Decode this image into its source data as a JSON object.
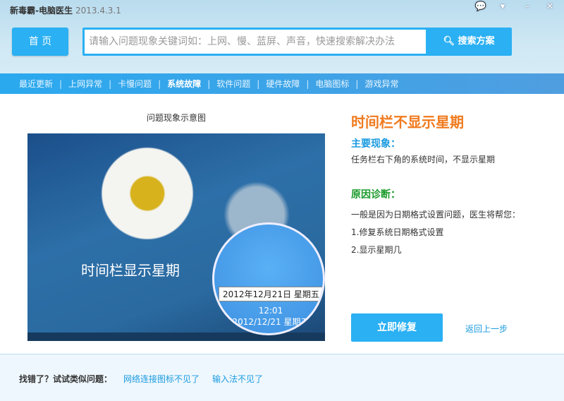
{
  "window": {
    "title": "新毒霸-电脑医生",
    "version": "2013.4.3.1"
  },
  "window_controls": [
    "chat-icon",
    "menu-icon",
    "minimize-icon",
    "close-icon"
  ],
  "home_button": "首 页",
  "search": {
    "placeholder": "请输入问题现象关键词如：上网、慢、蓝屏、声音，快速搜索解决办法",
    "button": "搜索方案"
  },
  "nav": [
    {
      "label": "最近更新",
      "active": false
    },
    {
      "label": "上网异常",
      "active": false
    },
    {
      "label": "卡慢问题",
      "active": false
    },
    {
      "label": "系统故障",
      "active": true
    },
    {
      "label": "软件问题",
      "active": false
    },
    {
      "label": "硬件故障",
      "active": false
    },
    {
      "label": "电脑图标",
      "active": false
    },
    {
      "label": "游戏异常",
      "active": false
    }
  ],
  "illustration": {
    "caption": "问题现象示意图",
    "overlay_text": "时间栏显示星期",
    "tooltip": "2012年12月21日 星期五",
    "clock_time": "12:01",
    "clock_date": "2012/12/21 星期五"
  },
  "problem": {
    "title": "时间栏不显示星期",
    "symptom_heading": "主要现象：",
    "symptom": "任务栏右下角的系统时间，不显示星期",
    "diagnosis_heading": "原因诊断：",
    "diagnosis": "一般是因为日期格式设置问题，医生将帮您：",
    "steps": [
      "1.修复系统日期格式设置",
      "2.显示星期几"
    ],
    "fix_button": "立即修复",
    "back_link": "返回上一步"
  },
  "footer": {
    "label": "找错了？试试类似问题：",
    "links": [
      "网络连接图标不见了",
      "输入法不见了"
    ]
  },
  "colors": {
    "accent": "#2ab0f3",
    "title_orange": "#f07a1e",
    "heading_blue": "#1b9be0",
    "heading_green": "#1a9a2a"
  }
}
